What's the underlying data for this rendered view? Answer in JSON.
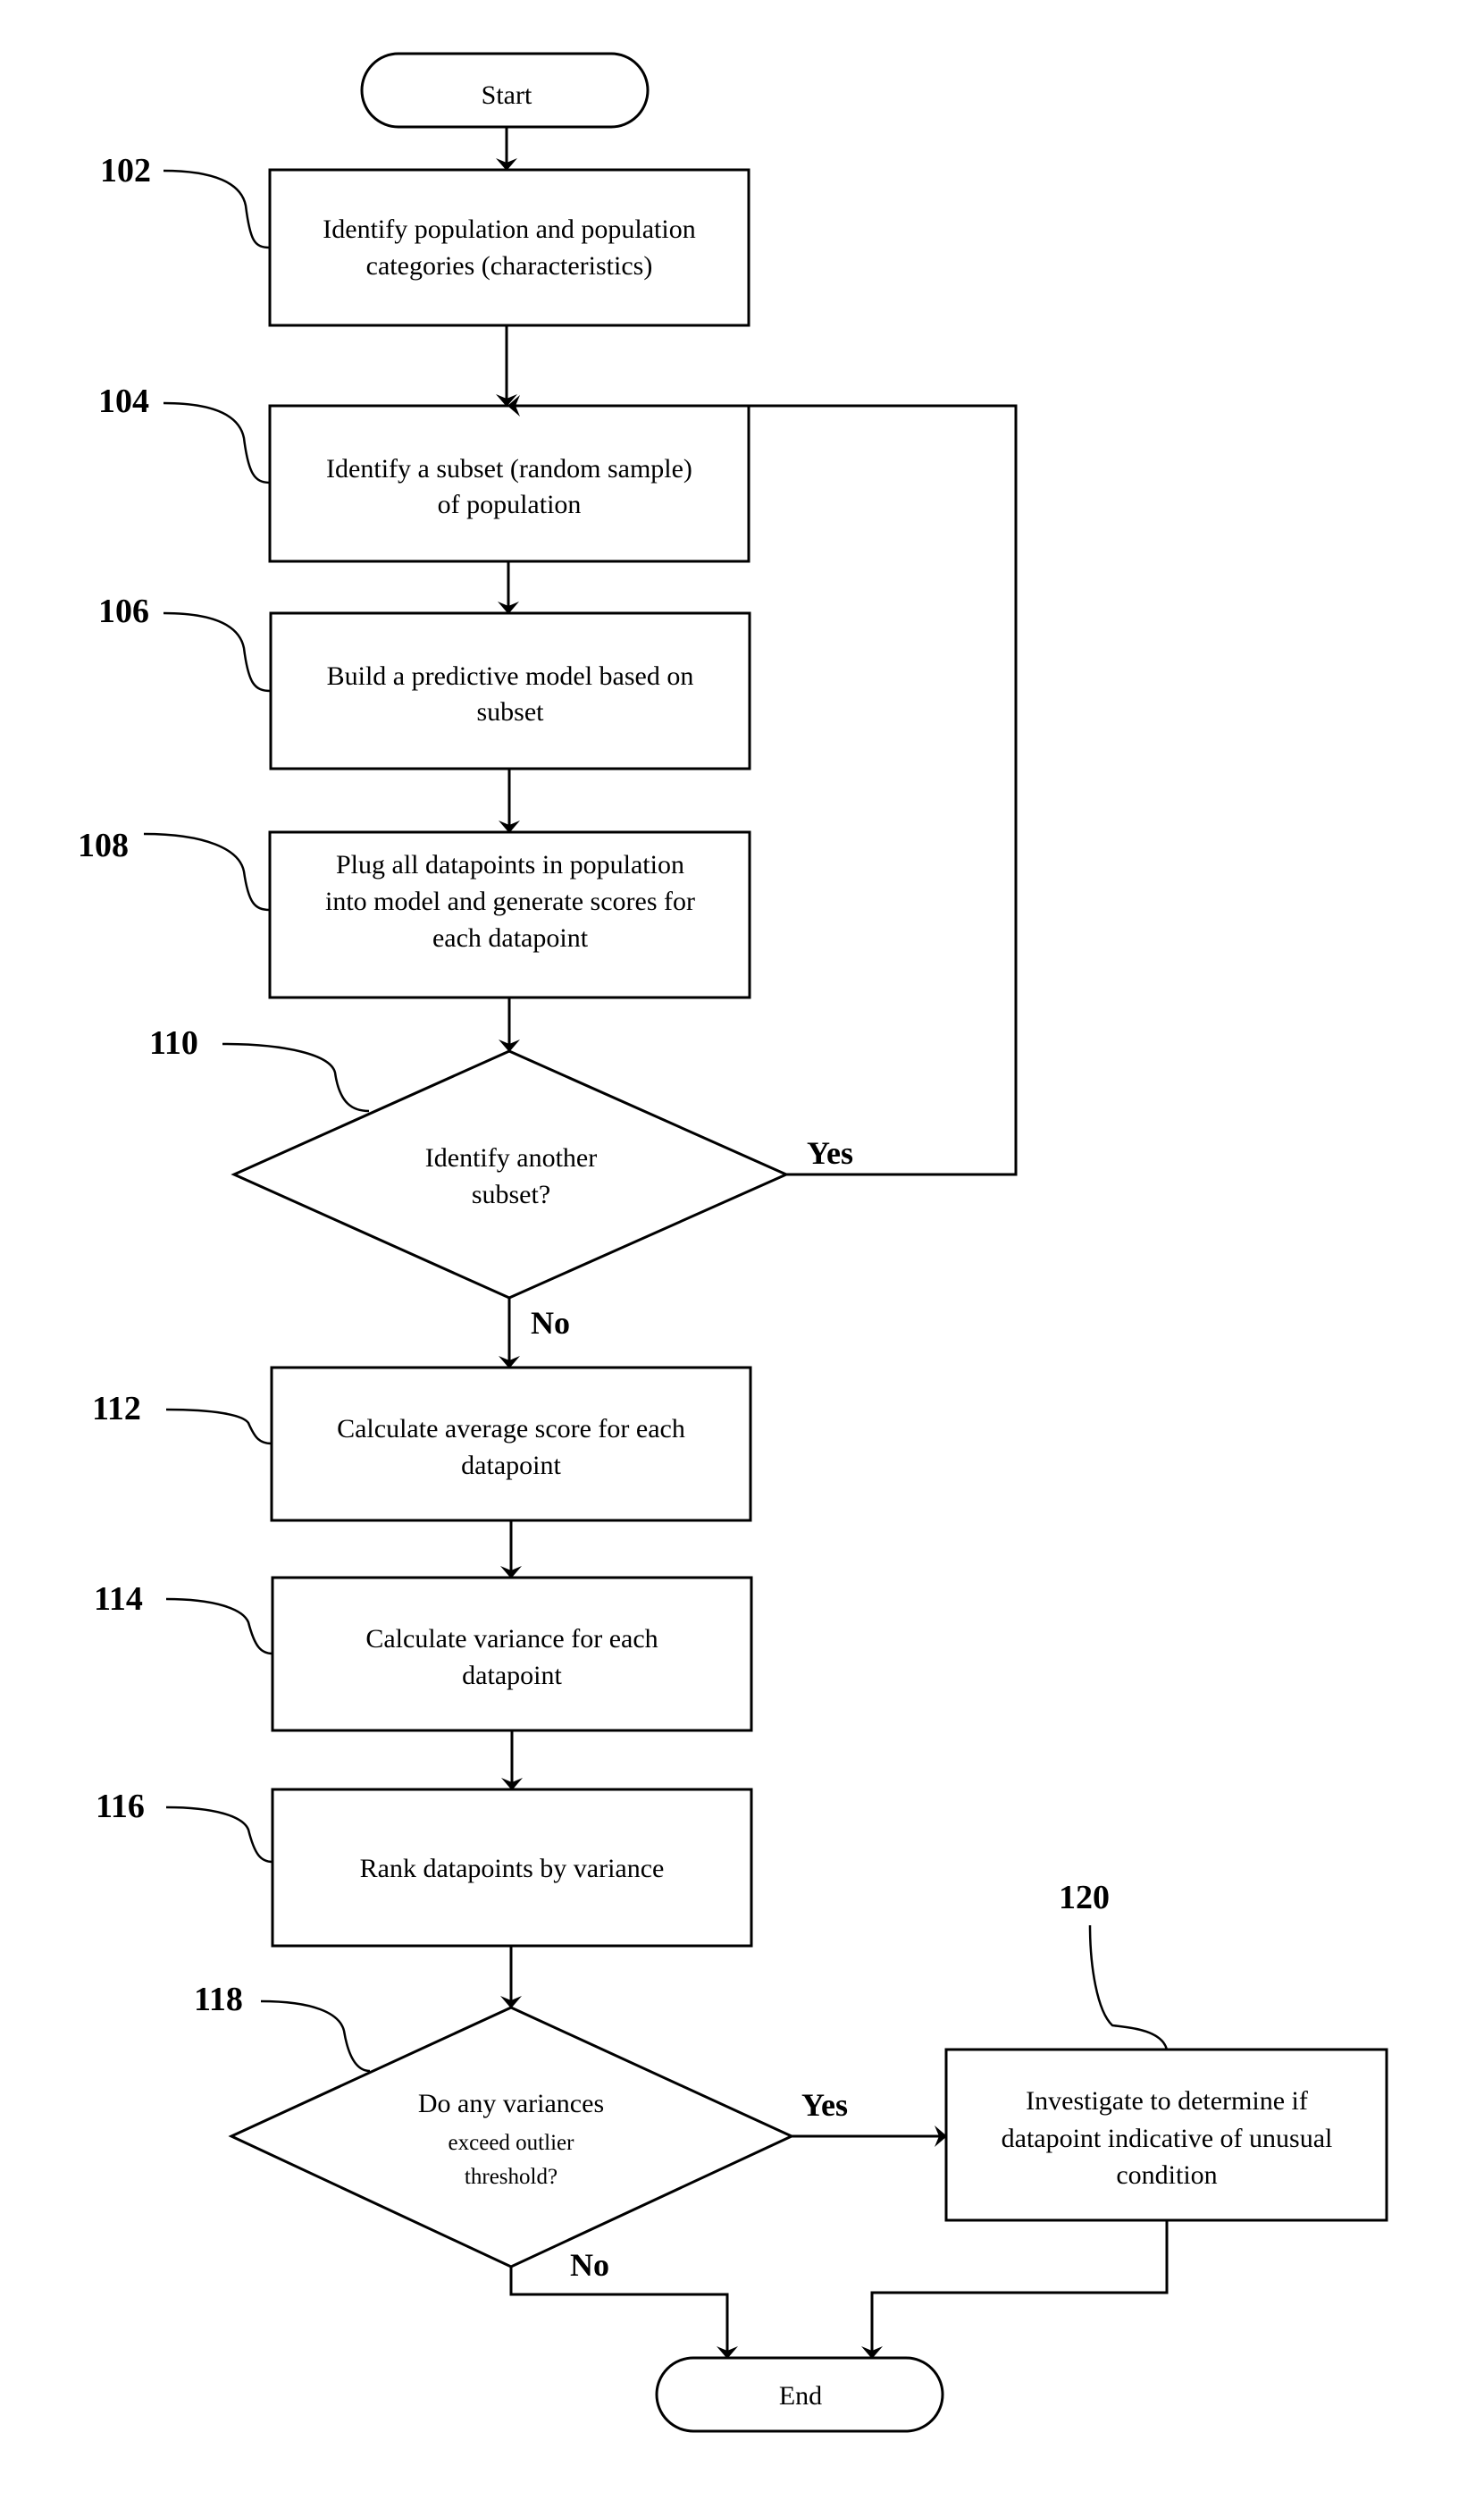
{
  "diagram": {
    "type": "flowchart",
    "colors": {
      "stroke": "#000000",
      "background": "#ffffff",
      "text": "#000000"
    },
    "terminals": {
      "start": {
        "label": "Start"
      },
      "end": {
        "label": "End"
      }
    },
    "steps": [
      {
        "ref": "102",
        "lines": [
          "Identify population and population",
          "categories (characteristics)"
        ]
      },
      {
        "ref": "104",
        "lines": [
          "Identify a subset (random sample)",
          "of population"
        ]
      },
      {
        "ref": "106",
        "lines": [
          "Build a predictive model based on",
          "subset"
        ]
      },
      {
        "ref": "108",
        "lines": [
          "Plug all datapoints in population",
          "into model and generate scores for",
          "each datapoint"
        ]
      },
      {
        "ref": "112",
        "lines": [
          "Calculate average score for each",
          "datapoint"
        ]
      },
      {
        "ref": "114",
        "lines": [
          "Calculate variance for each",
          "datapoint"
        ]
      },
      {
        "ref": "116",
        "lines": [
          "Rank datapoints by variance"
        ]
      },
      {
        "ref": "120",
        "lines": [
          "Investigate to determine if",
          "datapoint indicative of unusual",
          "condition"
        ]
      }
    ],
    "decisions": [
      {
        "ref": "110",
        "lines": [
          "Identify another",
          "subset?"
        ],
        "yes_label": "Yes",
        "no_label": "No"
      },
      {
        "ref": "118",
        "lines": [
          "Do any variances",
          "exceed outlier",
          "threshold?"
        ],
        "yes_label": "Yes",
        "no_label": "No"
      }
    ],
    "edges": [
      {
        "from": "Start",
        "to": "102"
      },
      {
        "from": "102",
        "to": "104"
      },
      {
        "from": "104",
        "to": "106"
      },
      {
        "from": "106",
        "to": "108"
      },
      {
        "from": "108",
        "to": "110"
      },
      {
        "from": "110",
        "to": "104",
        "label": "Yes"
      },
      {
        "from": "110",
        "to": "112",
        "label": "No"
      },
      {
        "from": "112",
        "to": "114"
      },
      {
        "from": "114",
        "to": "116"
      },
      {
        "from": "116",
        "to": "118"
      },
      {
        "from": "118",
        "to": "120",
        "label": "Yes"
      },
      {
        "from": "118",
        "to": "End",
        "label": "No"
      },
      {
        "from": "120",
        "to": "End"
      }
    ]
  }
}
